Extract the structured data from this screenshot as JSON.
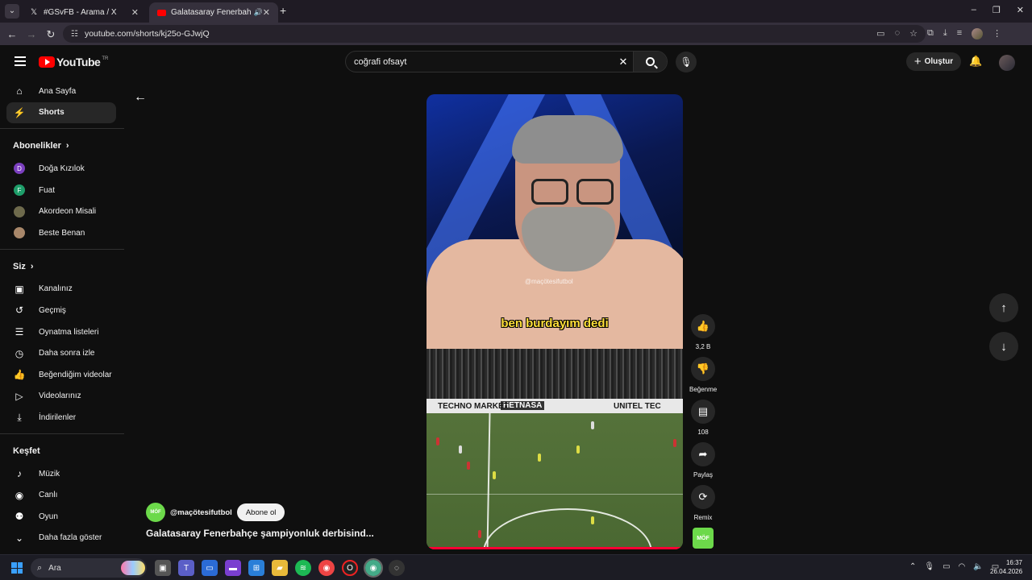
{
  "browser": {
    "tabs": [
      {
        "icon": "x-logo-icon",
        "label": "#GSvFB - Arama / X"
      },
      {
        "icon": "youtube-favicon-icon",
        "label": "Galatasaray Fenerbahçe şam"
      }
    ],
    "url": "youtube.com/shorts/kj25o-GJwjQ",
    "window_buttons": {
      "minimize": "–",
      "restore": "❐",
      "close": "✕"
    }
  },
  "youtube": {
    "logo_text": "YouTube",
    "logo_region": "TR",
    "search_value": "coğrafi ofsayt",
    "create_label": "Oluştur",
    "sidebar": {
      "main": [
        {
          "icon": "home-icon",
          "label": "Ana Sayfa"
        },
        {
          "icon": "shorts-icon",
          "label": "Shorts"
        }
      ],
      "subscriptions_heading": "Abonelikler",
      "subscriptions": [
        {
          "initial": "D",
          "color": "#7b3fbf",
          "label": "Doğa Kızılok"
        },
        {
          "initial": "F",
          "color": "#1e9e6a",
          "label": "Fuat"
        },
        {
          "initial": "",
          "color": "#6e6a4c",
          "label": "Akordeon Misali"
        },
        {
          "initial": "",
          "color": "#a8876a",
          "label": "Beste Benan"
        }
      ],
      "you_heading": "Siz",
      "you": [
        {
          "icon": "channel-icon",
          "label": "Kanalınız"
        },
        {
          "icon": "history-icon",
          "label": "Geçmiş"
        },
        {
          "icon": "playlists-icon",
          "label": "Oynatma listeleri"
        },
        {
          "icon": "watch-later-icon",
          "label": "Daha sonra izle"
        },
        {
          "icon": "liked-icon",
          "label": "Beğendiğim videolar"
        },
        {
          "icon": "your-videos-icon",
          "label": "Videolarınız"
        },
        {
          "icon": "downloads-icon",
          "label": "İndirilenler"
        }
      ],
      "explore_heading": "Keşfet",
      "explore": [
        {
          "icon": "music-icon",
          "label": "Müzik"
        },
        {
          "icon": "live-icon",
          "label": "Canlı"
        },
        {
          "icon": "gaming-icon",
          "label": "Oyun"
        },
        {
          "icon": "chevron-down-icon",
          "label": "Daha fazla göster"
        }
      ]
    },
    "short": {
      "watermark": "@maçötesifutbol",
      "caption": "ben burdayım dedi",
      "ad_boards": [
        "HETNASA",
        "TECHNO MARKET",
        "UNITEL TEC"
      ],
      "channel_avatar_text": "MÖF",
      "channel": "@maçötesifutbol",
      "subscribe_label": "Abone ol",
      "title": "Galatasaray Fenerbahçe şampiyonluk derbisind...",
      "progress": 1.0
    },
    "actions": {
      "like_count": "3,2 B",
      "dislike_label": "Beğenme",
      "comment_count": "108",
      "share_label": "Paylaş",
      "remix_label": "Remix"
    }
  },
  "taskbar": {
    "search_placeholder": "Ara",
    "time": "16:37",
    "date": "26.04.2026"
  }
}
